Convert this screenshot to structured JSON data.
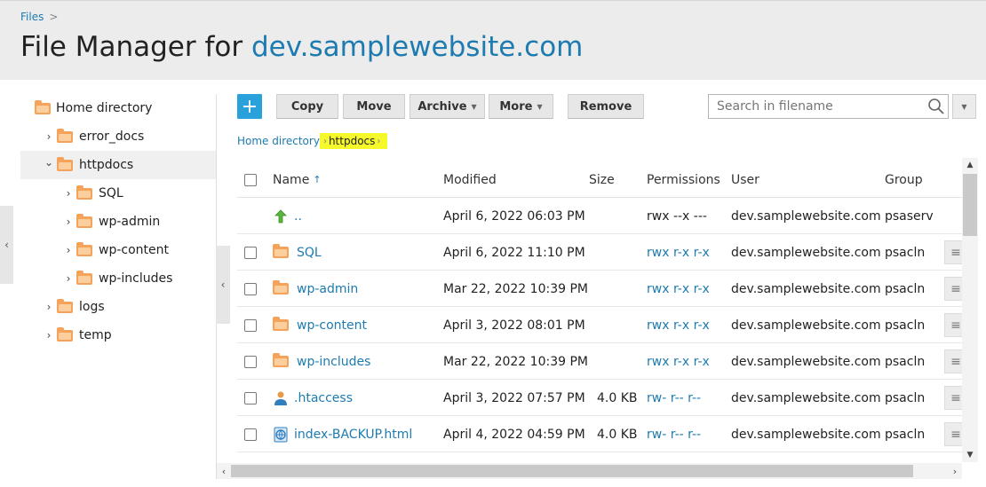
{
  "breadcrumb": {
    "root": "Files",
    "separator": ">"
  },
  "header": {
    "title_prefix": "File Manager for",
    "domain": "dev.samplewebsite.com"
  },
  "tree": {
    "items": [
      {
        "label": "Home directory",
        "icon": "folder-icon"
      },
      {
        "label": "error_docs",
        "icon": "folder-icon",
        "chevron": "›"
      },
      {
        "label": "httpdocs",
        "icon": "folder-icon",
        "chevron": "⌄",
        "selected": true
      },
      {
        "label": "SQL",
        "icon": "folder-icon",
        "chevron": "›"
      },
      {
        "label": "wp-admin",
        "icon": "folder-icon",
        "chevron": "›"
      },
      {
        "label": "wp-content",
        "icon": "folder-icon",
        "chevron": "›"
      },
      {
        "label": "wp-includes",
        "icon": "folder-icon",
        "chevron": "›"
      },
      {
        "label": "logs",
        "icon": "folder-icon",
        "chevron": "›"
      },
      {
        "label": "temp",
        "icon": "folder-icon",
        "chevron": "›"
      }
    ]
  },
  "toolbar": {
    "add_label": "+",
    "copy_label": "Copy",
    "move_label": "Move",
    "archive_label": "Archive",
    "more_label": "More",
    "remove_label": "Remove",
    "search_placeholder": "Search in filename"
  },
  "path": {
    "home": "Home directory",
    "current": "httpdocs"
  },
  "table": {
    "columns": {
      "name": "Name",
      "modified": "Modified",
      "size": "Size",
      "permissions": "Permissions",
      "user": "User",
      "group": "Group"
    },
    "rows": [
      {
        "name": "..",
        "type": "parent-dir",
        "modified": "April 6, 2022 06:03 PM",
        "size": "",
        "permissions": "rwx --x ---",
        "user": "dev.samplewebsite.com",
        "group": "psaserv"
      },
      {
        "name": "SQL",
        "type": "folder",
        "modified": "April 6, 2022 11:10 PM",
        "size": "",
        "permissions": "rwx r-x r-x",
        "user": "dev.samplewebsite.com",
        "group": "psacln"
      },
      {
        "name": "wp-admin",
        "type": "folder",
        "modified": "Mar 22, 2022 10:39 PM",
        "size": "",
        "permissions": "rwx r-x r-x",
        "user": "dev.samplewebsite.com",
        "group": "psacln"
      },
      {
        "name": "wp-content",
        "type": "folder",
        "modified": "April 3, 2022 08:01 PM",
        "size": "",
        "permissions": "rwx r-x r-x",
        "user": "dev.samplewebsite.com",
        "group": "psacln"
      },
      {
        "name": "wp-includes",
        "type": "folder",
        "modified": "Mar 22, 2022 10:39 PM",
        "size": "",
        "permissions": "rwx r-x r-x",
        "user": "dev.samplewebsite.com",
        "group": "psacln"
      },
      {
        "name": ".htaccess",
        "type": "htaccess",
        "modified": "April 3, 2022 07:57 PM",
        "size": "4.0 KB",
        "permissions": "rw- r-- r--",
        "user": "dev.samplewebsite.com",
        "group": "psacln"
      },
      {
        "name": "index-BACKUP.html",
        "type": "html",
        "modified": "April 4, 2022 04:59 PM",
        "size": "4.0 KB",
        "permissions": "rw- r-- r--",
        "user": "dev.samplewebsite.com",
        "group": "psacln"
      }
    ]
  },
  "colors": {
    "accent": "#1d7bb0",
    "add_button": "#2aa1db",
    "folder": "#f5a35b",
    "highlight": "#f5f82a"
  }
}
